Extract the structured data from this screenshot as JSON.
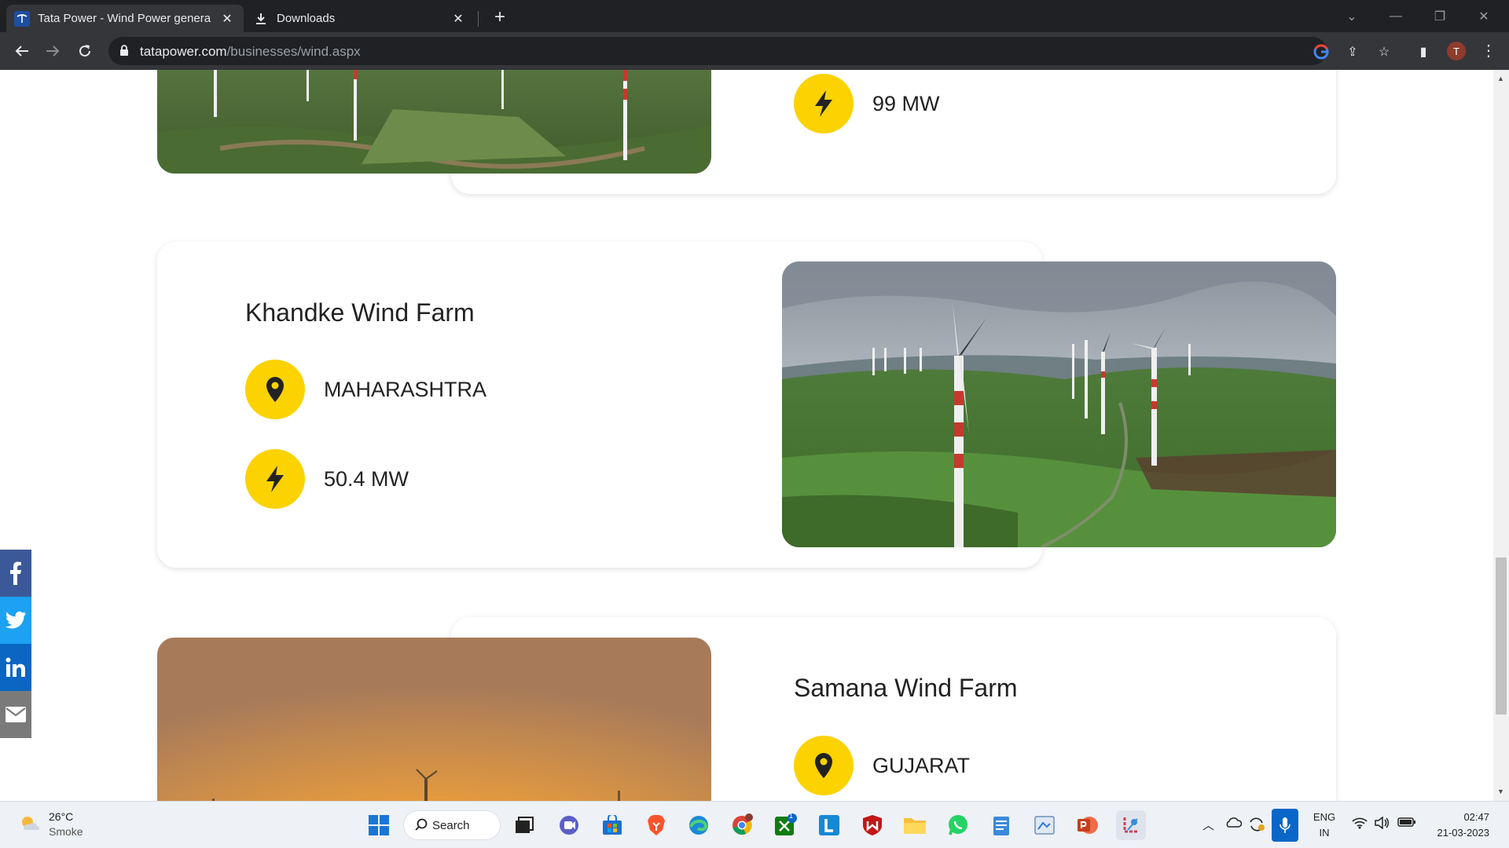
{
  "browser": {
    "tabs": [
      {
        "title": "Tata Power - Wind Power genera",
        "active": true,
        "favicon": "tata-logo"
      },
      {
        "title": "Downloads",
        "active": false,
        "favicon": "download-icon"
      }
    ],
    "url_host": "tatapower.com",
    "url_path": "/businesses/wind.aspx",
    "profile_initial": "T"
  },
  "page": {
    "farms": [
      {
        "name": "",
        "capacity": "99 MW"
      },
      {
        "name": "Khandke Wind Farm",
        "location": "MAHARASHTRA",
        "capacity": "50.4 MW"
      },
      {
        "name": "Samana Wind Farm",
        "location": "GUJARAT"
      }
    ],
    "social": [
      "facebook-icon",
      "twitter-icon",
      "linkedin-icon",
      "email-icon"
    ],
    "colors": {
      "accent": "#fcd200",
      "facebook": "#3b5998",
      "twitter": "#1da1f2",
      "linkedin": "#0a66c2",
      "email": "#7a7a7a"
    }
  },
  "taskbar": {
    "weather_temp": "26°C",
    "weather_desc": "Smoke",
    "search_label": "Search",
    "lang_primary": "ENG",
    "lang_secondary": "IN",
    "time": "02:47",
    "date": "21-03-2023",
    "xbox_badge": "1"
  }
}
